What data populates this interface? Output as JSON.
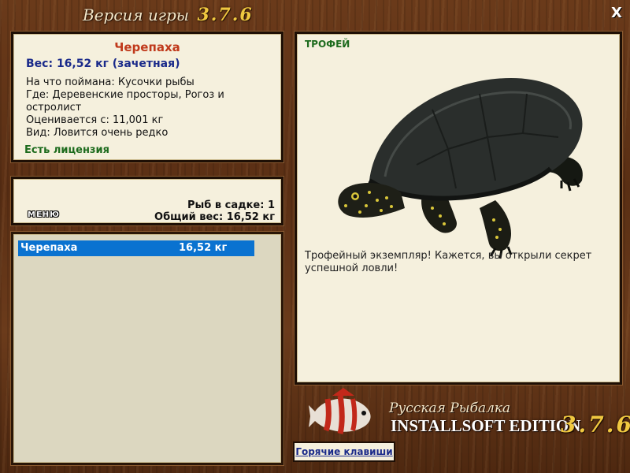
{
  "window": {
    "title": "Версия игры",
    "version": "3.7.6",
    "close_label": "X"
  },
  "fish_info": {
    "name": "Черепаха",
    "weight": "Вес: 16,52 кг (зачетная)",
    "bait": "На что поймана: Кусочки рыбы",
    "location": "Где: Деревенские просторы, Рогоз и остролист",
    "rated_from": "Оценивается с: 11,001 кг",
    "rarity": "Вид: Ловится очень редко",
    "license": "Есть лицензия"
  },
  "keepnet": {
    "menu_label": "МЕНЮ",
    "fish_count": "Рыб в садке: 1",
    "total_weight": "Общий вес: 16,52 кг"
  },
  "catch_list": [
    {
      "name": "Черепаха",
      "weight": "16,52 кг",
      "selected": true
    }
  ],
  "trophy": {
    "label": "ТРОФЕЙ",
    "message": "Трофейный экземпляр! Кажется, вы открыли секрет успешной ловли!"
  },
  "logo": {
    "subtitle": "Русская Рыбалка",
    "edition": "INSTALLSOFT EDITION",
    "version": "3.7.6"
  },
  "hotkeys_label": "Горячие клавиши",
  "colors": {
    "selection": "#0a72d0",
    "fish_name": "#c0391b",
    "weight_text": "#1a2a8a",
    "license_text": "#1d6b1d"
  }
}
